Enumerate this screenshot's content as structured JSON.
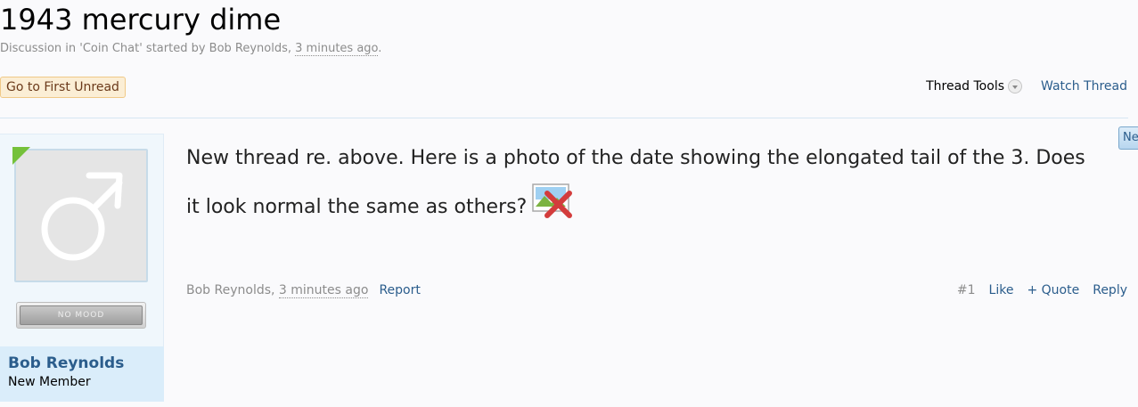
{
  "thread": {
    "title": "1943 mercury dime",
    "desc_prefix": "Discussion in 'Coin Chat' started by Bob Reynolds, ",
    "desc_time": "3 minutes ago",
    "desc_suffix": "."
  },
  "controls": {
    "first_unread": "Go to First Unread",
    "thread_tools": "Thread Tools",
    "watch_thread": "Watch Thread"
  },
  "user": {
    "name": "Bob Reynolds",
    "title": "New Member",
    "mood": "NO MOOD"
  },
  "post": {
    "message": "New thread re. above. Here is a photo of the date showing the elongated tail of the 3. Does it look normal the same as others?",
    "author": "Bob Reynolds",
    "time": "3 minutes ago",
    "report": "Report",
    "number": "#1",
    "like": "Like",
    "quote": "+ Quote",
    "reply": "Reply",
    "new_tag": "Ne"
  },
  "colors": {
    "link": "#2b5d8c",
    "muted": "#8c8c8c",
    "userblock_bg": "#f0f7fc",
    "user_extra_bg": "#daedfa"
  },
  "icons": {
    "dropdown": "chevron-down-circle-icon",
    "avatar": "male-symbol-icon",
    "broken_image": "broken-image-icon"
  }
}
